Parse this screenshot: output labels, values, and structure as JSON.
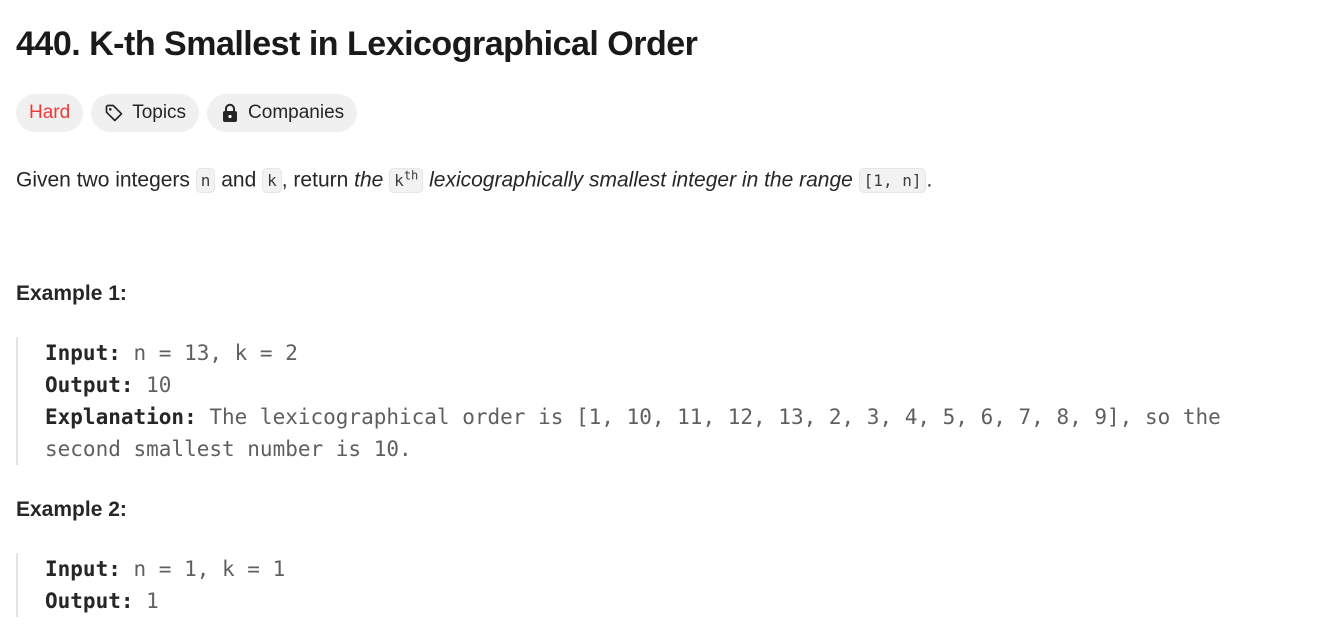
{
  "problem": {
    "title": "440. K-th Smallest in Lexicographical Order",
    "difficulty": "Hard",
    "topics_label": "Topics",
    "companies_label": "Companies",
    "description": {
      "p1": "Given two integers ",
      "code_n": "n",
      "p2": " and ",
      "code_k": "k",
      "p3": ", return ",
      "em1": "the ",
      "code_kth_base": "k",
      "code_kth_sup": "th",
      "em2": " lexicographically smallest integer in the range ",
      "code_range": "[1, n]",
      "p4": "."
    }
  },
  "examples": [
    {
      "title": "Example 1:",
      "input_label": "Input:",
      "input_value": " n = 13, k = 2",
      "output_label": "Output:",
      "output_value": " 10",
      "explanation_label": "Explanation:",
      "explanation_line1": " The lexicographical order is [1, 10, 11, 12, 13, 2, 3, 4, 5, 6, 7, 8, 9], so the",
      "explanation_line2": "second smallest number is 10."
    },
    {
      "title": "Example 2:",
      "input_label": "Input:",
      "input_value": " n = 1, k = 1",
      "output_label": "Output:",
      "output_value": " 1"
    }
  ],
  "icons": {
    "topics": "tag-icon",
    "companies": "lock-icon"
  },
  "colors": {
    "hard": "#f63636",
    "tag_bg": "#f0f0f0"
  }
}
